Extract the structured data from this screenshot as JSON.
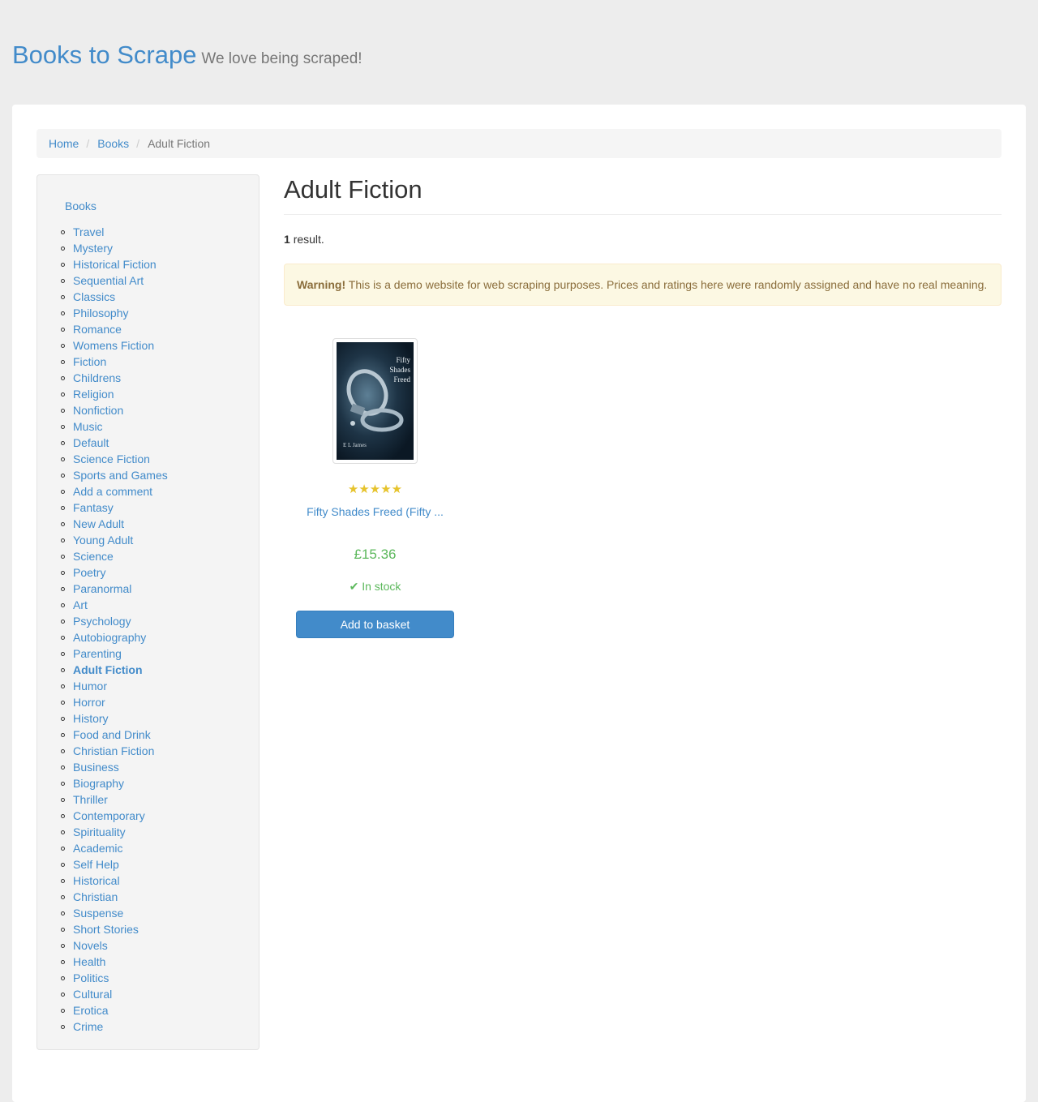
{
  "header": {
    "brand": "Books to Scrape",
    "tagline": "We love being scraped!"
  },
  "breadcrumb": {
    "home": "Home",
    "books": "Books",
    "current": "Adult Fiction",
    "separator": "/"
  },
  "sidebar": {
    "root": "Books",
    "items": [
      "Travel",
      "Mystery",
      "Historical Fiction",
      "Sequential Art",
      "Classics",
      "Philosophy",
      "Romance",
      "Womens Fiction",
      "Fiction",
      "Childrens",
      "Religion",
      "Nonfiction",
      "Music",
      "Default",
      "Science Fiction",
      "Sports and Games",
      "Add a comment",
      "Fantasy",
      "New Adult",
      "Young Adult",
      "Science",
      "Poetry",
      "Paranormal",
      "Art",
      "Psychology",
      "Autobiography",
      "Parenting",
      "Adult Fiction",
      "Humor",
      "Horror",
      "History",
      "Food and Drink",
      "Christian Fiction",
      "Business",
      "Biography",
      "Thriller",
      "Contemporary",
      "Spirituality",
      "Academic",
      "Self Help",
      "Historical",
      "Christian",
      "Suspense",
      "Short Stories",
      "Novels",
      "Health",
      "Politics",
      "Cultural",
      "Erotica",
      "Crime"
    ],
    "active": "Adult Fiction"
  },
  "main": {
    "title": "Adult Fiction",
    "result_count": "1",
    "result_label": "result.",
    "warning_strong": "Warning!",
    "warning_text": "This is a demo website for web scraping purposes. Prices and ratings here were randomly assigned and have no real meaning."
  },
  "product": {
    "cover_title_lines": [
      "Fifty",
      "Shades",
      "Freed"
    ],
    "cover_author": "E L James",
    "rating": 5,
    "title": "Fifty Shades Freed (Fifty ...",
    "price": "£15.36",
    "stock": "In stock",
    "button": "Add to basket"
  },
  "colors": {
    "accent": "#428bca",
    "success": "#5cb85c",
    "star": "#e6c32c",
    "warning_bg": "#fcf8e3"
  }
}
